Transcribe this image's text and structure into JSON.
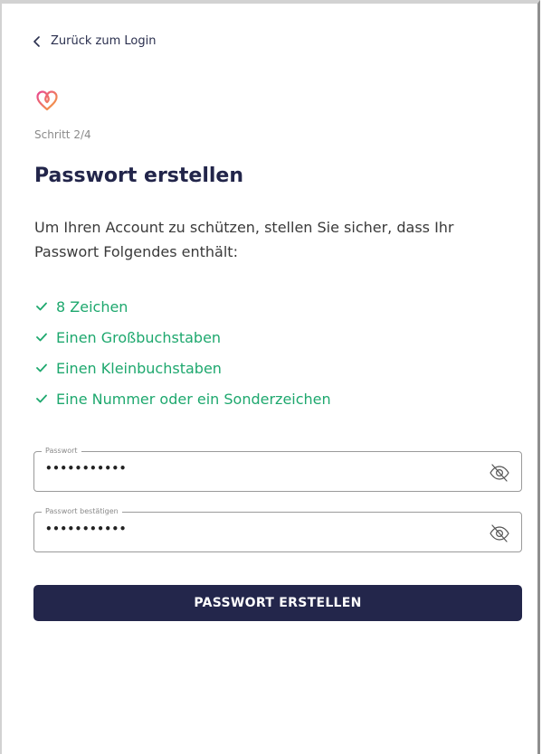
{
  "nav": {
    "back_label": "Zurück zum Login"
  },
  "step": {
    "label": "Schritt 2/4"
  },
  "page": {
    "title": "Passwort erstellen",
    "intro": "Um Ihren Account zu schützen, stellen Sie sicher, dass Ihr Passwort Folgendes enthält:"
  },
  "requirements": [
    {
      "label": "8 Zeichen",
      "met": true
    },
    {
      "label": "Einen Großbuchstaben",
      "met": true
    },
    {
      "label": "Einen Kleinbuchstaben",
      "met": true
    },
    {
      "label": "Eine Nummer oder ein Sonderzeichen",
      "met": true
    }
  ],
  "form": {
    "password": {
      "label": "Passwort",
      "value": "•••••••••••",
      "icon": "eye-off-icon"
    },
    "password_confirm": {
      "label": "Passwort bestätigen",
      "value": "•••••••••••",
      "icon": "eye-off-icon"
    },
    "submit_label": "PASSWORT ERSTELLEN"
  },
  "colors": {
    "primary": "#23264b",
    "success": "#1ea86e",
    "logo_gradient_start": "#e8468f",
    "logo_gradient_end": "#f4a23b"
  }
}
